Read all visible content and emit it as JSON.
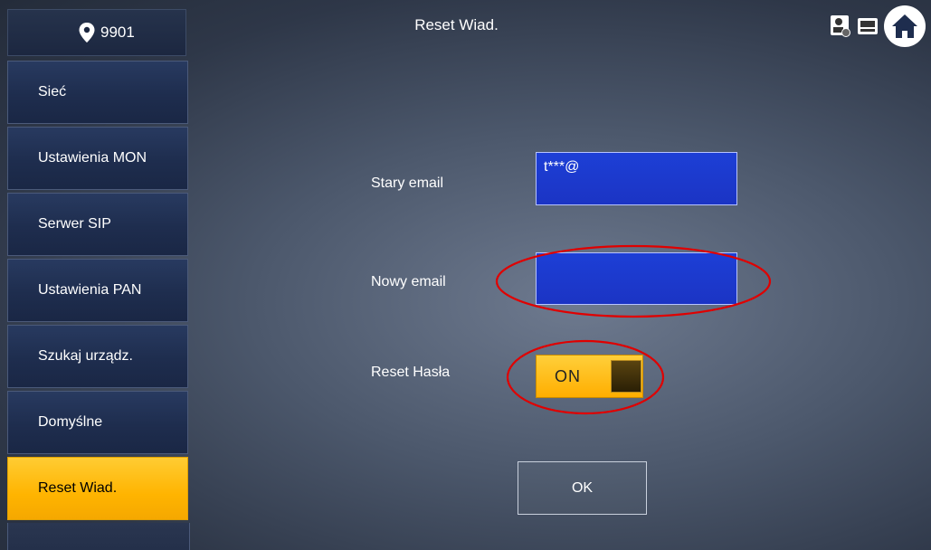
{
  "header": {
    "location_number": "9901",
    "title": "Reset Wiad.",
    "icons": [
      "location-pin-icon",
      "monitor-icon",
      "intercom-icon",
      "home-icon"
    ]
  },
  "sidebar": {
    "items": [
      {
        "label": "Sieć",
        "active": false
      },
      {
        "label": "Ustawienia MON",
        "active": false
      },
      {
        "label": "Serwer SIP",
        "active": false
      },
      {
        "label": "Ustawienia PAN",
        "active": false
      },
      {
        "label": "Szukaj urządz.",
        "active": false
      },
      {
        "label": "Domyślne",
        "active": false
      },
      {
        "label": "Reset Wiad.",
        "active": true
      }
    ]
  },
  "form": {
    "old_email": {
      "label": "Stary email",
      "value": "t***@"
    },
    "new_email": {
      "label": "Nowy email",
      "value": ""
    },
    "reset_password": {
      "label": "Reset Hasła",
      "state": "ON"
    },
    "ok_label": "OK"
  },
  "colors": {
    "accent_yellow": "#ffb400",
    "field_blue": "#1d3fd6",
    "highlight_red": "#e00000"
  }
}
